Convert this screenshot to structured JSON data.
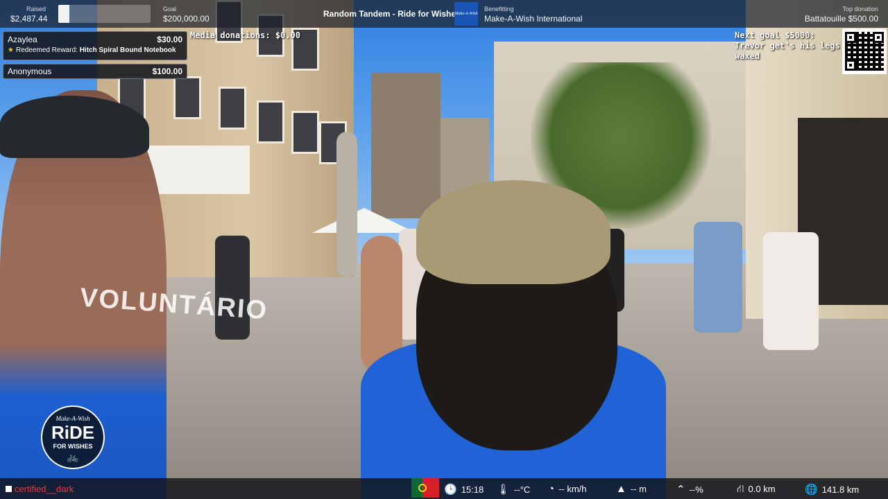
{
  "header": {
    "raised_label": "Raised",
    "raised_value": "$2,487.44",
    "raised_progress": 0.124,
    "goal_label": "Goal",
    "goal_value": "$200,000.00",
    "stream_title": "Random Tandem - Ride for Wishes",
    "charity_logo_text": "Make-A-Wish",
    "benefitting_label": "Benefitting",
    "benefitting_value": "Make-A-Wish International",
    "top_donation_label": "Top donation",
    "top_donation_value": "Battatouille $500.00"
  },
  "alerts": [
    {
      "name": "Azaylea",
      "amount": "$30.00",
      "reward_prefix": "Redeemed Reward:",
      "reward_name": "Hitch Spiral Bound Notebook"
    },
    {
      "name": "Anonymous",
      "amount": "$100.00"
    }
  ],
  "overlay": {
    "media_donations": "Media donations: $0.00",
    "next_goal_line1": "Next goal $5000:",
    "next_goal_line2": "Trevor get's his legs",
    "next_goal_line3": "waxed"
  },
  "badge": {
    "line1": "Make-A-Wish",
    "line2": "RiDE",
    "line3": "FOR WISHES",
    "icon": "bicycle-icon"
  },
  "bottom_bar": {
    "username": "certified__dark",
    "time": "15:18",
    "temperature": "--°C",
    "speed": "-- km/h",
    "altitude": "-- m",
    "incline": "--%",
    "distance_trip": "0.0 km",
    "distance_total": "141.8 km"
  },
  "scene": {
    "shirt_text": "VOLUNTÁRIO"
  },
  "colors": {
    "bar_bg": "#1c2028",
    "brand_blue": "#1a55b5",
    "username_red": "#e33b3b",
    "shirt_blue": "#1f63d6"
  }
}
